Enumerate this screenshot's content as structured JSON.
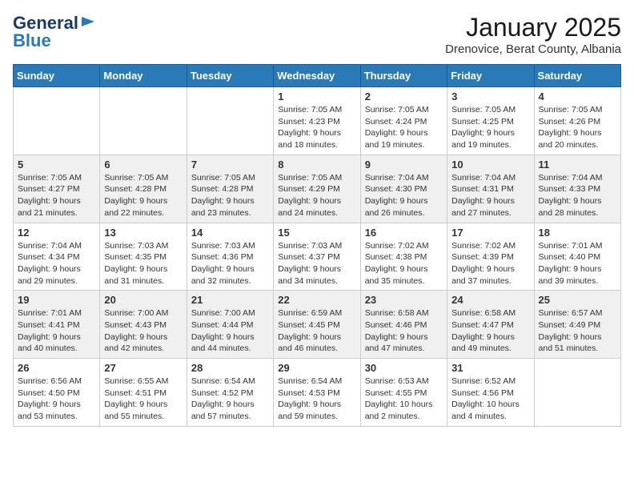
{
  "logo": {
    "general": "General",
    "blue": "Blue",
    "tagline": ""
  },
  "title": "January 2025",
  "subtitle": "Drenovice, Berat County, Albania",
  "days_of_week": [
    "Sunday",
    "Monday",
    "Tuesday",
    "Wednesday",
    "Thursday",
    "Friday",
    "Saturday"
  ],
  "weeks": [
    [
      {
        "day": "",
        "empty": true
      },
      {
        "day": "",
        "empty": true
      },
      {
        "day": "",
        "empty": true
      },
      {
        "day": "1",
        "sunrise": "7:05 AM",
        "sunset": "4:23 PM",
        "daylight": "9 hours and 18 minutes."
      },
      {
        "day": "2",
        "sunrise": "7:05 AM",
        "sunset": "4:24 PM",
        "daylight": "9 hours and 19 minutes."
      },
      {
        "day": "3",
        "sunrise": "7:05 AM",
        "sunset": "4:25 PM",
        "daylight": "9 hours and 19 minutes."
      },
      {
        "day": "4",
        "sunrise": "7:05 AM",
        "sunset": "4:26 PM",
        "daylight": "9 hours and 20 minutes."
      }
    ],
    [
      {
        "day": "5",
        "sunrise": "7:05 AM",
        "sunset": "4:27 PM",
        "daylight": "9 hours and 21 minutes."
      },
      {
        "day": "6",
        "sunrise": "7:05 AM",
        "sunset": "4:28 PM",
        "daylight": "9 hours and 22 minutes."
      },
      {
        "day": "7",
        "sunrise": "7:05 AM",
        "sunset": "4:28 PM",
        "daylight": "9 hours and 23 minutes."
      },
      {
        "day": "8",
        "sunrise": "7:05 AM",
        "sunset": "4:29 PM",
        "daylight": "9 hours and 24 minutes."
      },
      {
        "day": "9",
        "sunrise": "7:04 AM",
        "sunset": "4:30 PM",
        "daylight": "9 hours and 26 minutes."
      },
      {
        "day": "10",
        "sunrise": "7:04 AM",
        "sunset": "4:31 PM",
        "daylight": "9 hours and 27 minutes."
      },
      {
        "day": "11",
        "sunrise": "7:04 AM",
        "sunset": "4:33 PM",
        "daylight": "9 hours and 28 minutes."
      }
    ],
    [
      {
        "day": "12",
        "sunrise": "7:04 AM",
        "sunset": "4:34 PM",
        "daylight": "9 hours and 29 minutes."
      },
      {
        "day": "13",
        "sunrise": "7:03 AM",
        "sunset": "4:35 PM",
        "daylight": "9 hours and 31 minutes."
      },
      {
        "day": "14",
        "sunrise": "7:03 AM",
        "sunset": "4:36 PM",
        "daylight": "9 hours and 32 minutes."
      },
      {
        "day": "15",
        "sunrise": "7:03 AM",
        "sunset": "4:37 PM",
        "daylight": "9 hours and 34 minutes."
      },
      {
        "day": "16",
        "sunrise": "7:02 AM",
        "sunset": "4:38 PM",
        "daylight": "9 hours and 35 minutes."
      },
      {
        "day": "17",
        "sunrise": "7:02 AM",
        "sunset": "4:39 PM",
        "daylight": "9 hours and 37 minutes."
      },
      {
        "day": "18",
        "sunrise": "7:01 AM",
        "sunset": "4:40 PM",
        "daylight": "9 hours and 39 minutes."
      }
    ],
    [
      {
        "day": "19",
        "sunrise": "7:01 AM",
        "sunset": "4:41 PM",
        "daylight": "9 hours and 40 minutes."
      },
      {
        "day": "20",
        "sunrise": "7:00 AM",
        "sunset": "4:43 PM",
        "daylight": "9 hours and 42 minutes."
      },
      {
        "day": "21",
        "sunrise": "7:00 AM",
        "sunset": "4:44 PM",
        "daylight": "9 hours and 44 minutes."
      },
      {
        "day": "22",
        "sunrise": "6:59 AM",
        "sunset": "4:45 PM",
        "daylight": "9 hours and 46 minutes."
      },
      {
        "day": "23",
        "sunrise": "6:58 AM",
        "sunset": "4:46 PM",
        "daylight": "9 hours and 47 minutes."
      },
      {
        "day": "24",
        "sunrise": "6:58 AM",
        "sunset": "4:47 PM",
        "daylight": "9 hours and 49 minutes."
      },
      {
        "day": "25",
        "sunrise": "6:57 AM",
        "sunset": "4:49 PM",
        "daylight": "9 hours and 51 minutes."
      }
    ],
    [
      {
        "day": "26",
        "sunrise": "6:56 AM",
        "sunset": "4:50 PM",
        "daylight": "9 hours and 53 minutes."
      },
      {
        "day": "27",
        "sunrise": "6:55 AM",
        "sunset": "4:51 PM",
        "daylight": "9 hours and 55 minutes."
      },
      {
        "day": "28",
        "sunrise": "6:54 AM",
        "sunset": "4:52 PM",
        "daylight": "9 hours and 57 minutes."
      },
      {
        "day": "29",
        "sunrise": "6:54 AM",
        "sunset": "4:53 PM",
        "daylight": "9 hours and 59 minutes."
      },
      {
        "day": "30",
        "sunrise": "6:53 AM",
        "sunset": "4:55 PM",
        "daylight": "10 hours and 2 minutes."
      },
      {
        "day": "31",
        "sunrise": "6:52 AM",
        "sunset": "4:56 PM",
        "daylight": "10 hours and 4 minutes."
      },
      {
        "day": "",
        "empty": true
      }
    ]
  ]
}
